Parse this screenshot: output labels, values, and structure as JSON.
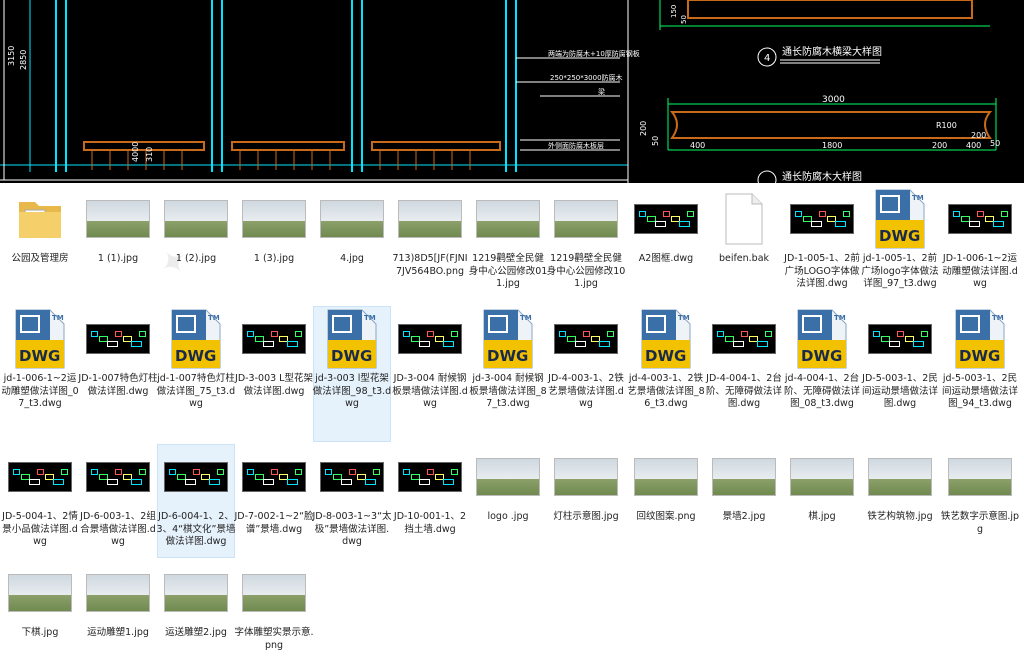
{
  "cad_drawing": {
    "dims_vertical": [
      "3150",
      "2850",
      "4000",
      "310"
    ],
    "notes": [
      "两端为防腐木+10厚防腐钢板",
      "250*250*3000防腐木",
      "梁",
      "外侧面防腐木板层"
    ],
    "section4_title": "通长防腐木横梁大样图",
    "section4_number": "4",
    "dims_top": [
      "150",
      "50"
    ],
    "dims_lower": [
      "3000",
      "200",
      "400",
      "1800",
      "200",
      "400",
      "R100",
      "200",
      "50",
      "50"
    ],
    "next_title": "通长防腐木大样图"
  },
  "files": [
    {
      "name": "公园及管理房",
      "type": "folder"
    },
    {
      "name": "1 (1).jpg",
      "type": "photo"
    },
    {
      "name": "1 (2).jpg",
      "type": "photo"
    },
    {
      "name": "1 (3).jpg",
      "type": "photo"
    },
    {
      "name": "4.jpg",
      "type": "photo"
    },
    {
      "name": "713)8D5[JF(FJNI7JV564BO.png",
      "type": "photo"
    },
    {
      "name": "1219鹳壁全民健身中心公园修改011.jpg",
      "type": "photo"
    },
    {
      "name": "1219鹳壁全民健身中心公园修改101.jpg",
      "type": "photo"
    },
    {
      "name": "A2图框.dwg",
      "type": "cad"
    },
    {
      "name": "beifen.bak",
      "type": "blank"
    },
    {
      "name": "JD-1-005-1、2前广场LOGO字体做法详图.dwg",
      "type": "cad"
    },
    {
      "name": "jd-1-005-1、2前广场logo字体做法详图_97_t3.dwg",
      "type": "dwg"
    },
    {
      "name": "JD-1-006-1~2运动雕塑做法详图.dwg",
      "type": "cad"
    },
    {
      "name": "jd-1-006-1~2运动雕塑做法详图_07_t3.dwg",
      "type": "dwg"
    },
    {
      "name": "JD-1-007特色灯柱做法详图.dwg",
      "type": "cad"
    },
    {
      "name": "jd-1-007特色灯柱做法详图_75_t3.dwg",
      "type": "dwg"
    },
    {
      "name": "JD-3-003 L型花架做法详图.dwg",
      "type": "cad"
    },
    {
      "name": "jd-3-003 l型花架做法详图_98_t3.dwg",
      "type": "dwg"
    },
    {
      "name": "JD-3-004 耐候钢板景墙做法详图.dwg",
      "type": "cad"
    },
    {
      "name": "jd-3-004 耐候钢板景墙做法详图_87_t3.dwg",
      "type": "dwg"
    },
    {
      "name": "JD-4-003-1、2铁艺景墙做法详图.dwg",
      "type": "cad"
    },
    {
      "name": "jd-4-003-1、2铁艺景墙做法详图_86_t3.dwg",
      "type": "dwg"
    },
    {
      "name": "JD-4-004-1、2台阶、无障碍做法详图.dwg",
      "type": "cad"
    },
    {
      "name": "jd-4-004-1、2台阶、无障碍做法详图_08_t3.dwg",
      "type": "dwg"
    },
    {
      "name": "JD-5-003-1、2民间运动景墙做法详图.dwg",
      "type": "cad"
    },
    {
      "name": "jd-5-003-1、2民间运动景墙做法详图_94_t3.dwg",
      "type": "dwg"
    },
    {
      "name": "JD-5-004-1、2情景小品做法详图.dwg",
      "type": "cad"
    },
    {
      "name": "JD-6-003-1、2组合景墙做法详图.dwg",
      "type": "cad"
    },
    {
      "name": "JD-6-004-1、2、3、4“棋文化”景墙做法详图.dwg",
      "type": "cad"
    },
    {
      "name": "JD-7-002-1~2“脸谱”景墙.dwg",
      "type": "cad"
    },
    {
      "name": "JD-8-003-1~3“太极”景墙做法详图.dwg",
      "type": "cad"
    },
    {
      "name": "JD-10-001-1、2挡土墙.dwg",
      "type": "cad"
    },
    {
      "name": "logo .jpg",
      "type": "photo"
    },
    {
      "name": "灯柱示意图.jpg",
      "type": "photo"
    },
    {
      "name": "回纹图案.png",
      "type": "photo"
    },
    {
      "name": "景墙2.jpg",
      "type": "photo"
    },
    {
      "name": "棋.jpg",
      "type": "photo"
    },
    {
      "name": "铁艺构筑物.jpg",
      "type": "photo"
    },
    {
      "name": "铁艺数字示意图.jpg",
      "type": "photo"
    },
    {
      "name": "下棋.jpg",
      "type": "photo"
    },
    {
      "name": "运动雕塑1.jpg",
      "type": "photo"
    },
    {
      "name": "运送雕塑2.jpg",
      "type": "photo"
    },
    {
      "name": "字体雕塑实景示意.png",
      "type": "photo"
    }
  ],
  "dwg_icon": {
    "text": "DWG",
    "tm": "TM"
  }
}
